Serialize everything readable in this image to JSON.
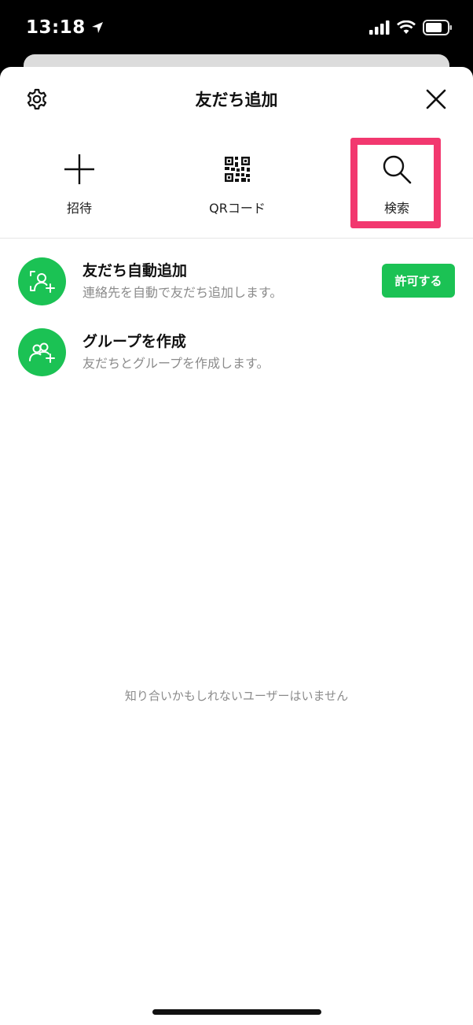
{
  "status_bar": {
    "time": "13:18"
  },
  "header": {
    "title": "友だち追加"
  },
  "actions": [
    {
      "label": "招待",
      "icon": "plus-icon"
    },
    {
      "label": "QRコード",
      "icon": "qr-code-icon"
    },
    {
      "label": "検索",
      "icon": "search-icon"
    }
  ],
  "rows": [
    {
      "title": "友だち自動追加",
      "subtitle": "連絡先を自動で友だち追加します。",
      "button_label": "許可する",
      "icon": "auto-add-friend-icon"
    },
    {
      "title": "グループを作成",
      "subtitle": "友だちとグループを作成します。",
      "icon": "create-group-icon"
    }
  ],
  "empty_message": "知り合いかもしれないユーザーはいません",
  "colors": {
    "accent_green": "#1bc254",
    "highlight_pink": "#f2386f"
  }
}
